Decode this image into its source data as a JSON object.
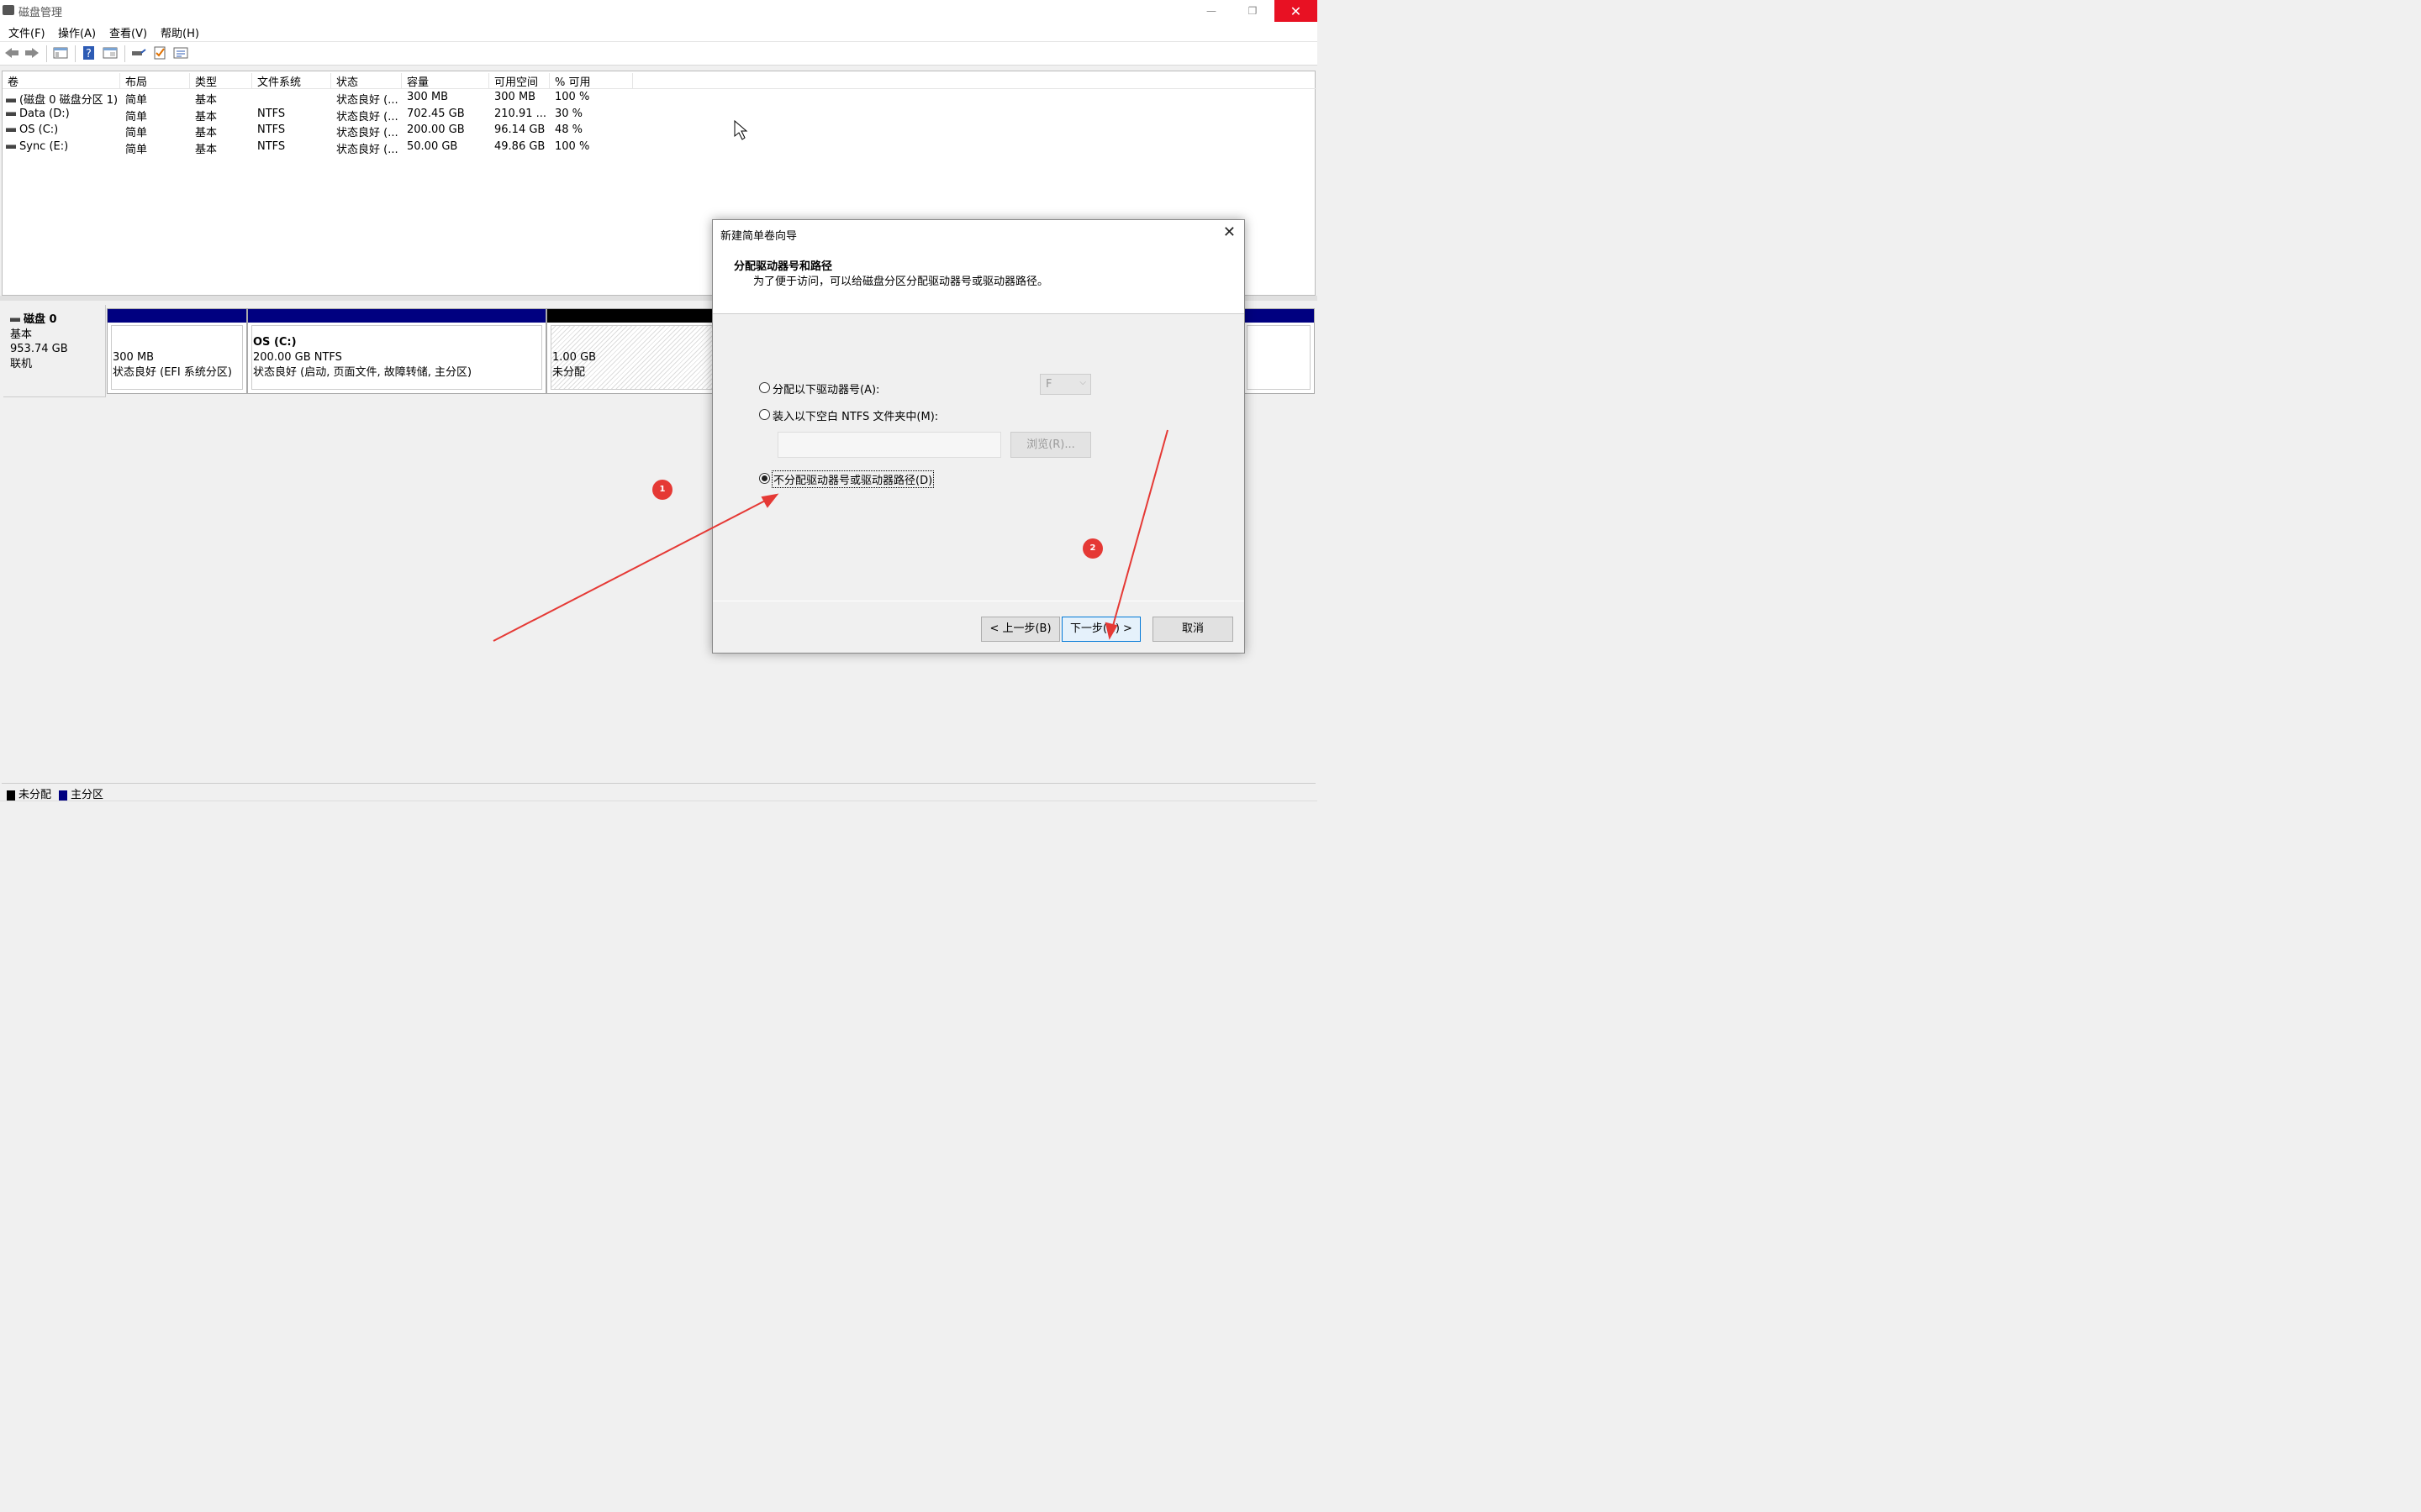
{
  "window": {
    "title": "磁盘管理"
  },
  "menu": [
    "文件(F)",
    "操作(A)",
    "查看(V)",
    "帮助(H)"
  ],
  "columns": [
    "卷",
    "布局",
    "类型",
    "文件系统",
    "状态",
    "容量",
    "可用空间",
    "% 可用"
  ],
  "volumes": [
    {
      "name": "(磁盘 0 磁盘分区 1)",
      "layout": "简单",
      "type": "基本",
      "fs": "",
      "status": "状态良好 (...",
      "capacity": "300 MB",
      "free": "300 MB",
      "pct": "100 %"
    },
    {
      "name": "Data (D:)",
      "layout": "简单",
      "type": "基本",
      "fs": "NTFS",
      "status": "状态良好 (...",
      "capacity": "702.45 GB",
      "free": "210.91 ...",
      "pct": "30 %"
    },
    {
      "name": "OS (C:)",
      "layout": "简单",
      "type": "基本",
      "fs": "NTFS",
      "status": "状态良好 (...",
      "capacity": "200.00 GB",
      "free": "96.14 GB",
      "pct": "48 %"
    },
    {
      "name": "Sync (E:)",
      "layout": "简单",
      "type": "基本",
      "fs": "NTFS",
      "status": "状态良好 (...",
      "capacity": "50.00 GB",
      "free": "49.86 GB",
      "pct": "100 %"
    }
  ],
  "disk": {
    "name": "磁盘 0",
    "type": "基本",
    "size": "953.74 GB",
    "state": "联机",
    "partitions": [
      {
        "title": "",
        "size": "300 MB",
        "status": "状态良好 (EFI 系统分区)"
      },
      {
        "title": "OS  (C:)",
        "size": "200.00 GB NTFS",
        "status": "状态良好 (启动, 页面文件, 故障转储, 主分区)"
      },
      {
        "title": "",
        "size": "1.00 GB",
        "status": "未分配"
      }
    ]
  },
  "legend": {
    "unallocated": "未分配",
    "primary": "主分区",
    "unallocated_color": "#000000",
    "primary_color": "#000080"
  },
  "dialog": {
    "title": "新建简单卷向导",
    "heading": "分配驱动器号和路径",
    "subheading": "为了便于访问，可以给磁盘分区分配驱动器号或驱动器路径。",
    "option1": "分配以下驱动器号(A):",
    "option2": "装入以下空白 NTFS 文件夹中(M):",
    "option3": "不分配驱动器号或驱动器路径(D)",
    "drive_letter": "F",
    "browse": "浏览(R)...",
    "back": "< 上一步(B)",
    "next": "下一步(N) >",
    "cancel": "取消",
    "selected_option": 3
  },
  "annotations": [
    "1",
    "2"
  ],
  "accent": "#0078d7",
  "annotation_color": "#e53935"
}
